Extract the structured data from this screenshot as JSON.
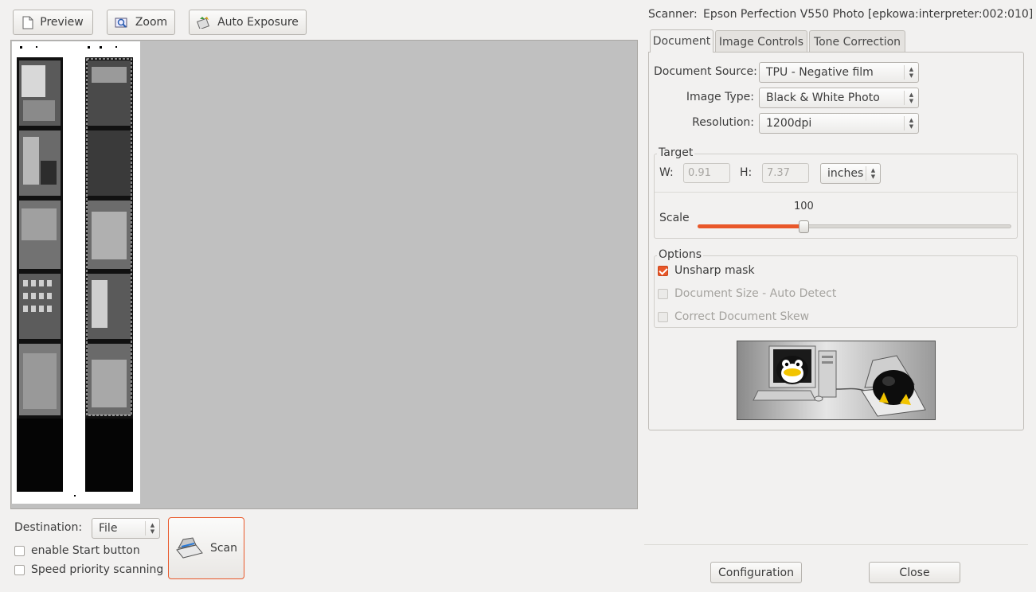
{
  "toolbar": {
    "preview_label": "Preview",
    "zoom_label": "Zoom",
    "auto_exposure_label": "Auto Exposure"
  },
  "scanner": {
    "label": "Scanner:",
    "name": "Epson Perfection V550 Photo [epkowa:interpreter:002:010]"
  },
  "tabs": [
    {
      "label": "Document",
      "active": true
    },
    {
      "label": "Image Controls",
      "active": false
    },
    {
      "label": "Tone Correction",
      "active": false
    }
  ],
  "document": {
    "source_label": "Document Source:",
    "source_value": "TPU - Negative film",
    "image_type_label": "Image Type:",
    "image_type_value": "Black & White Photo",
    "resolution_label": "Resolution:",
    "resolution_value": "1200dpi"
  },
  "target": {
    "title": "Target",
    "w_label": "W:",
    "w_value": "0.91",
    "h_label": "H:",
    "h_value": "7.37",
    "unit_value": "inches",
    "scale_label": "Scale",
    "scale_value": "100",
    "scale_fraction": 0.34
  },
  "options": {
    "title": "Options",
    "unsharp_label": "Unsharp mask",
    "unsharp_checked": true,
    "autodetect_label": "Document Size - Auto Detect",
    "skew_label": "Correct Document Skew"
  },
  "bottom": {
    "destination_label": "Destination:",
    "destination_value": "File",
    "enable_start_label": "enable Start button",
    "speed_label": "Speed priority scanning",
    "scan_label": "Scan",
    "configuration_label": "Configuration",
    "close_label": "Close"
  },
  "colors": {
    "accent": "#e9582a",
    "window_bg": "#f2f1f0",
    "preview_bg": "#c0c0c0"
  }
}
